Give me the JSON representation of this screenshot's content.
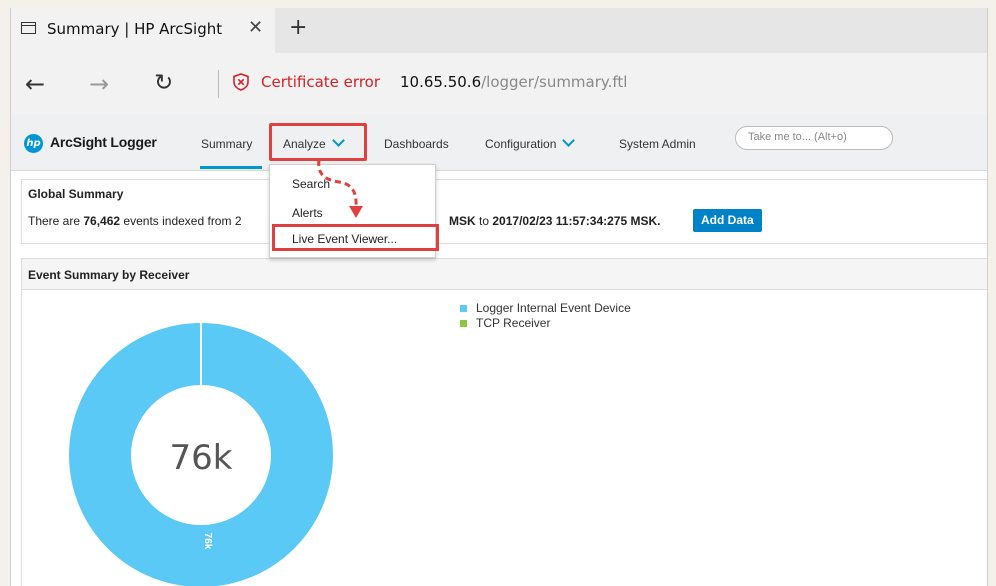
{
  "browser": {
    "tab_title": "Summary | HP ArcSight",
    "tab_close": "✕",
    "new_tab": "+",
    "back": "←",
    "forward": "→",
    "refresh": "↻",
    "cert_error": "Certificate error",
    "url_host": "10.65.50.6",
    "url_path": "/logger/summary.ftl"
  },
  "app": {
    "logo_mark": "hp",
    "brand": "ArcSight Logger",
    "nav": {
      "summary": "Summary",
      "analyze": "Analyze",
      "dashboards": "Dashboards",
      "configuration": "Configuration",
      "system_admin": "System Admin"
    },
    "search_placeholder": "Take me to... (Alt+o)"
  },
  "analyze_menu": {
    "items": [
      "Search",
      "Alerts",
      "Live Event Viewer..."
    ]
  },
  "global_summary": {
    "title": "Global Summary",
    "prefix": "There are",
    "count": "76,462",
    "middle": "events indexed from",
    "start_fragment": "2",
    "end_fragment": "MSK",
    "to": "to",
    "end_time": "2017/02/23 11:57:34:275 MSK.",
    "add_data": "Add Data"
  },
  "event_summary": {
    "title": "Event Summary by Receiver",
    "center_label": "76k",
    "slice_label": "76k",
    "legend": [
      {
        "label": "Logger Internal Event Device",
        "color": "#5bc9f5"
      },
      {
        "label": "TCP Receiver",
        "color": "#8cc63f"
      }
    ],
    "share": [
      1.0,
      0.0
    ]
  },
  "colors": {
    "accent": "#0096d6",
    "highlight": "#e0403f",
    "cert_error": "#d42027",
    "donut": "#5bc9f5"
  }
}
